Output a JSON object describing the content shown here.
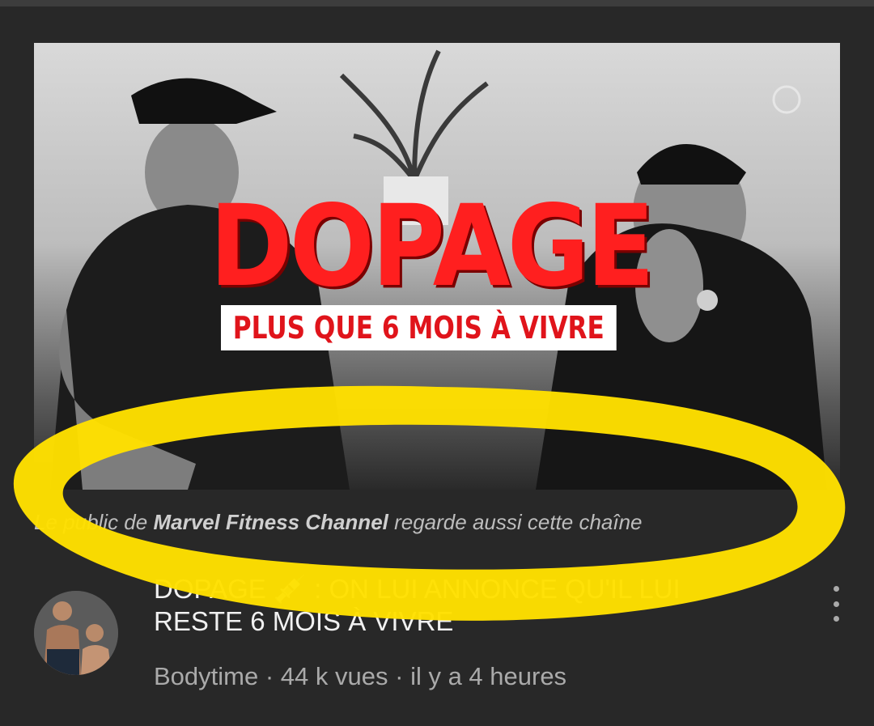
{
  "thumbnail": {
    "title": "DOPAGE",
    "subtitle": "PLUS QUE 6 MOIS À VIVRE"
  },
  "context": {
    "prefix": "Le public de ",
    "channel": "Marvel Fitness Channel",
    "suffix": " regarde aussi cette chaîne"
  },
  "video": {
    "title": "DOPAGE 💉 : ON LUI ANNONCE QU'IL LUI RESTE 6 MOIS À VIVRE",
    "channel": "Bodytime",
    "views": "44 k vues",
    "age": "il y a 4 heures",
    "separator": " · "
  },
  "icons": {
    "more": "more-vert-icon",
    "highlight": "yellow-ellipse-annotation"
  },
  "colors": {
    "background": "#282828",
    "thumbnail_title": "#ff1f1f",
    "highlight": "#ffe000",
    "meta_text": "#aaaaaa"
  }
}
